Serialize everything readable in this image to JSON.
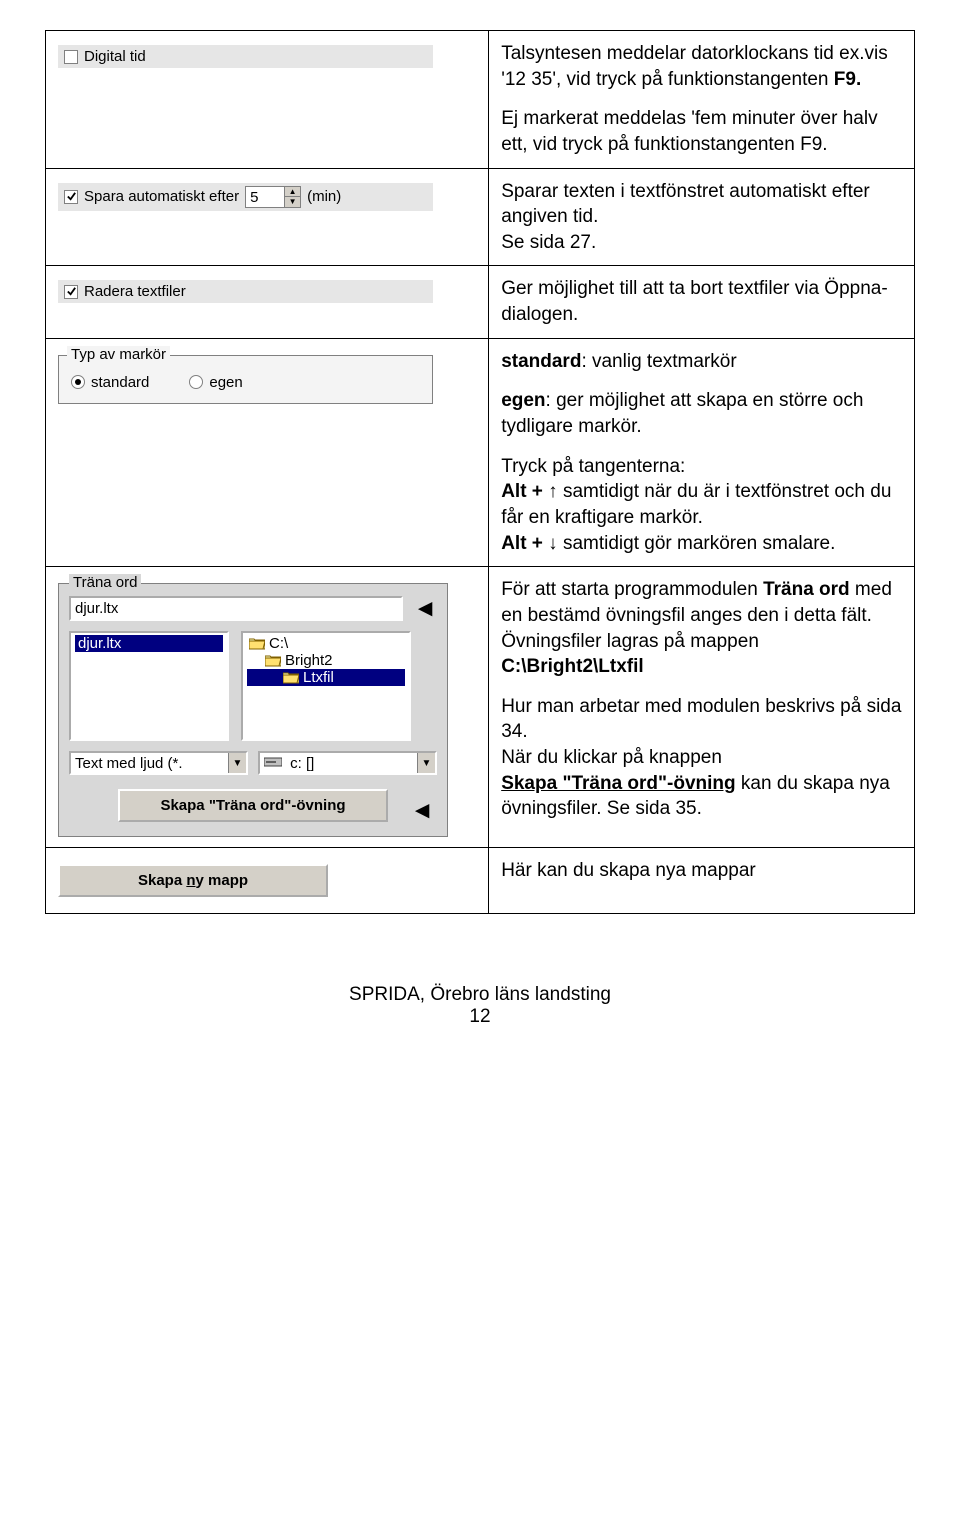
{
  "row1": {
    "ctrl": {
      "label": "Digital tid",
      "checked": false
    },
    "p1": "Talsyntesen meddelar datorklockans tid ex.vis  '12 35', vid tryck på funktionstangenten ",
    "p1b": "F9.",
    "p2": "Ej markerat meddelas 'fem minuter över halv ett, vid tryck på funktionstangenten F9."
  },
  "row2": {
    "ctrl": {
      "label": "Spara automatiskt efter",
      "checked": true,
      "value": "5",
      "unit": "(min)"
    },
    "p1": "Sparar texten i textfönstret automatiskt efter angiven tid.",
    "p2": "Se sida 27."
  },
  "row3": {
    "ctrl": {
      "label": "Radera textfiler",
      "checked": true
    },
    "p1": "Ger möjlighet till att ta bort textfiler via Öppna-dialogen."
  },
  "row4": {
    "group": {
      "legend": "Typ av markör",
      "opt1": "standard",
      "opt2": "egen"
    },
    "p1a": "standard",
    "p1b": ": vanlig textmarkör",
    "p2a": "egen",
    "p2b": ": ger möjlighet att skapa en större och tydligare markör.",
    "p3": "Tryck på tangenterna:",
    "p4a": "Alt + ",
    "p4arrow": "↑",
    "p4b": " samtidigt när du är i textfönstret och du får en kraftigare markör.",
    "p5a": "Alt + ",
    "p5arrow": "↓",
    "p5b": " samtidigt gör markören smalare."
  },
  "row5": {
    "panel": {
      "legend": "Träna ord",
      "fileInput": "djur.ltx",
      "listSel": "djur.ltx",
      "dir0": "C:\\",
      "dir1": "Bright2",
      "dir2": "Ltxfil",
      "filter": "Text med ljud (*.",
      "drive": "c: []",
      "button": "Skapa \"Träna ord\"-övning"
    },
    "p1a": "För att starta programmodulen ",
    "p1b": "Träna ord",
    "p1c": "  med en bestämd övningsfil anges den i detta fält.",
    "p2": "Övningsfiler lagras på mappen",
    "p2b": "C:\\Bright2\\Ltxfil",
    "p3": "Hur man arbetar med modulen beskrivs på sida 34.",
    "p4": "När du klickar på knappen",
    "p5a": "Skapa \"Träna ord\"-övning",
    "p5b": " kan du skapa nya övningsfiler. Se sida 35."
  },
  "row6": {
    "btn_pre": "Skapa ",
    "btn_u": "n",
    "btn_post": "y mapp",
    "p1": "Här kan du skapa nya mappar"
  },
  "footer": {
    "org": "SPRIDA, Örebro läns landsting",
    "page": "12"
  }
}
